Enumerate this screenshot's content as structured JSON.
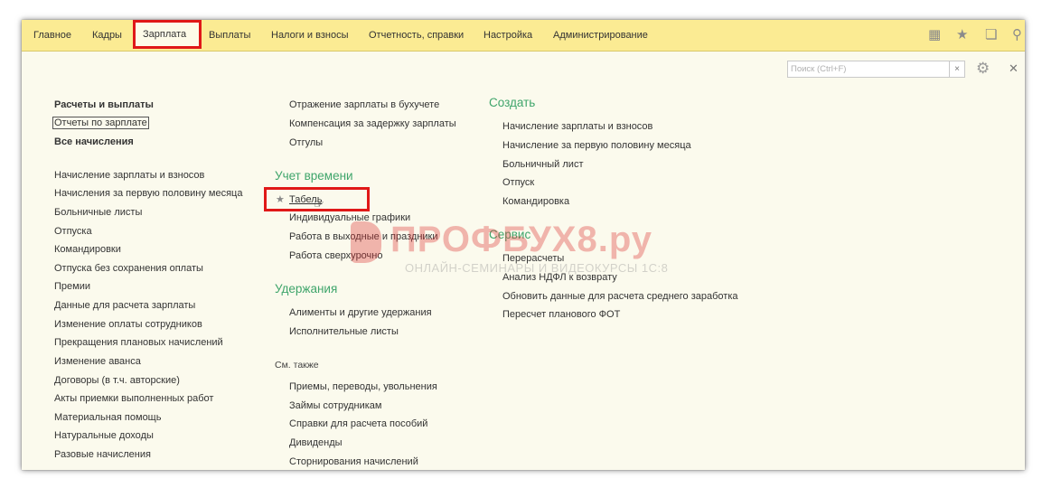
{
  "menu": {
    "tabs": [
      "Главное",
      "Кадры",
      "Зарплата",
      "Выплаты",
      "Налоги и взносы",
      "Отчетность, справки",
      "Настройка",
      "Администрирование"
    ],
    "active_tab": "Зарплата"
  },
  "search": {
    "placeholder": "Поиск (Ctrl+F)",
    "clear": "×"
  },
  "col1": {
    "top": [
      "Расчеты и выплаты",
      "Отчеты по зарплате",
      "Все начисления"
    ],
    "items": [
      "Начисление зарплаты и взносов",
      "Начисления за первую половину месяца",
      "Больничные листы",
      "Отпуска",
      "Командировки",
      "Отпуска без сохранения оплаты",
      "Премии",
      "Данные для расчета зарплаты",
      "Изменение оплаты сотрудников",
      "Прекращения плановых начислений",
      "Изменение аванса",
      "Договоры (в т.ч. авторские)",
      "Акты приемки выполненных работ",
      "Материальная помощь",
      "Натуральные доходы",
      "Разовые начисления"
    ]
  },
  "col2": {
    "top": [
      "Отражение зарплаты в бухучете",
      "Компенсация за задержку зарплаты",
      "Отгулы"
    ],
    "time_heading": "Учет времени",
    "time_items": [
      "Табель",
      "Индивидуальные графики",
      "Работа в выходные и праздники",
      "Работа сверхурочно"
    ],
    "deductions_heading": "Удержания",
    "deductions_items": [
      "Алименты и другие удержания",
      "Исполнительные листы"
    ],
    "see_also_label": "См. также",
    "see_also_items": [
      "Приемы, переводы, увольнения",
      "Займы сотрудникам",
      "Справки для расчета пособий",
      "Дивиденды",
      "Сторнирования начислений"
    ]
  },
  "col3": {
    "create_heading": "Создать",
    "create_items": [
      "Начисление зарплаты и взносов",
      "Начисление за первую половину месяца",
      "Больничный лист",
      "Отпуск",
      "Командировка"
    ],
    "service_heading": "Сервис",
    "service_items": [
      "Перерасчеты",
      "Анализ НДФЛ к возврату",
      "Обновить данные для расчета среднего заработка",
      "Пересчет планового ФОТ"
    ]
  },
  "watermark": {
    "title": "ПРОФБУХ8.ру",
    "subtitle": "ОНЛАЙН-СЕМИНАРЫ И ВИДЕОКУРСЫ 1С:8"
  },
  "colors": {
    "accent_green": "#3fa56b",
    "menu_bar": "#fbeb93",
    "highlight_red": "#e01818"
  }
}
